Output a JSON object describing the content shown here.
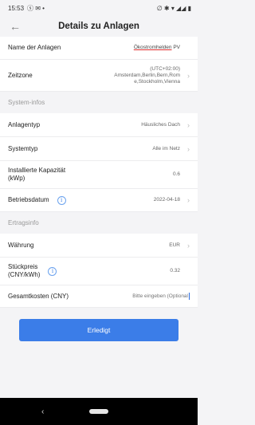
{
  "status": {
    "time": "15:53",
    "left_icons": "ⓢ ✉ •",
    "right_icons": "∅ ✱ ▾ ◢◢ ▮"
  },
  "header": {
    "back_icon": "←",
    "title": "Details zu Anlagen"
  },
  "rows": {
    "name": {
      "label": "Name der Anlagen",
      "value_underlined": "Ökostromhelden",
      "value_rest": " PV"
    },
    "timezone": {
      "label": "Zeitzone",
      "value_line1": "(UTC+02:00)",
      "value_line2": "Amsterdam,Berlin,Bern,Rom",
      "value_line3": "e,Stockholm,Vienna"
    },
    "plant_type": {
      "label": "Anlagentyp",
      "value": "Häusliches Dach"
    },
    "system_type": {
      "label": "Systemtyp",
      "value": "Alle im Netz"
    },
    "capacity": {
      "label_line1": "Installierte Kapazität",
      "label_line2": "(kWp)",
      "value": "0.6"
    },
    "start_date": {
      "label": "Betriebsdatum",
      "value": "2022-04-18"
    },
    "currency": {
      "label": "Währung",
      "value": "EUR"
    },
    "unit_price": {
      "label_line1": "Stückpreis",
      "label_line2": "(CNY/kWh)",
      "value": "0.32"
    },
    "total_cost": {
      "label": "Gesamtkosten (CNY)",
      "placeholder": "Bitte eingeben (Optional"
    }
  },
  "sections": {
    "system_info": "System-infos",
    "yield_info": "Ertragsinfo"
  },
  "chevron": "›",
  "info_icon": "i",
  "footer": {
    "done_label": "Erledigt"
  },
  "navbar": {
    "back_icon": "‹"
  },
  "colors": {
    "accent": "#3b7de8",
    "background": "#f4f4f6"
  }
}
